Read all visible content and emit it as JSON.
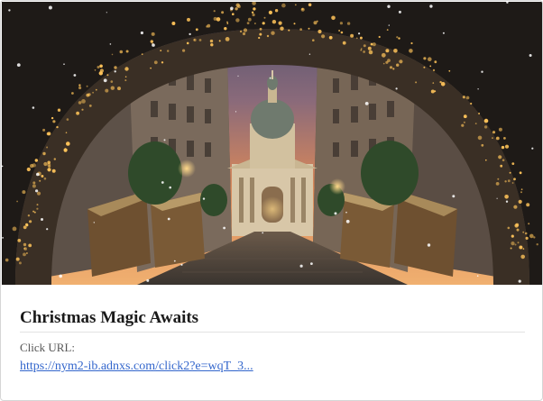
{
  "card": {
    "title": "Christmas Magic Awaits",
    "click_url_label": "Click URL:",
    "click_url": "https://nym2-ib.adnxs.com/click2?e=wqT_3..."
  },
  "colors": {
    "link": "#3366cc",
    "title": "#1a1a1a",
    "label": "#555555"
  },
  "hero_image": {
    "subject": "christmas-market-street-with-lit-arch-and-basilica"
  }
}
